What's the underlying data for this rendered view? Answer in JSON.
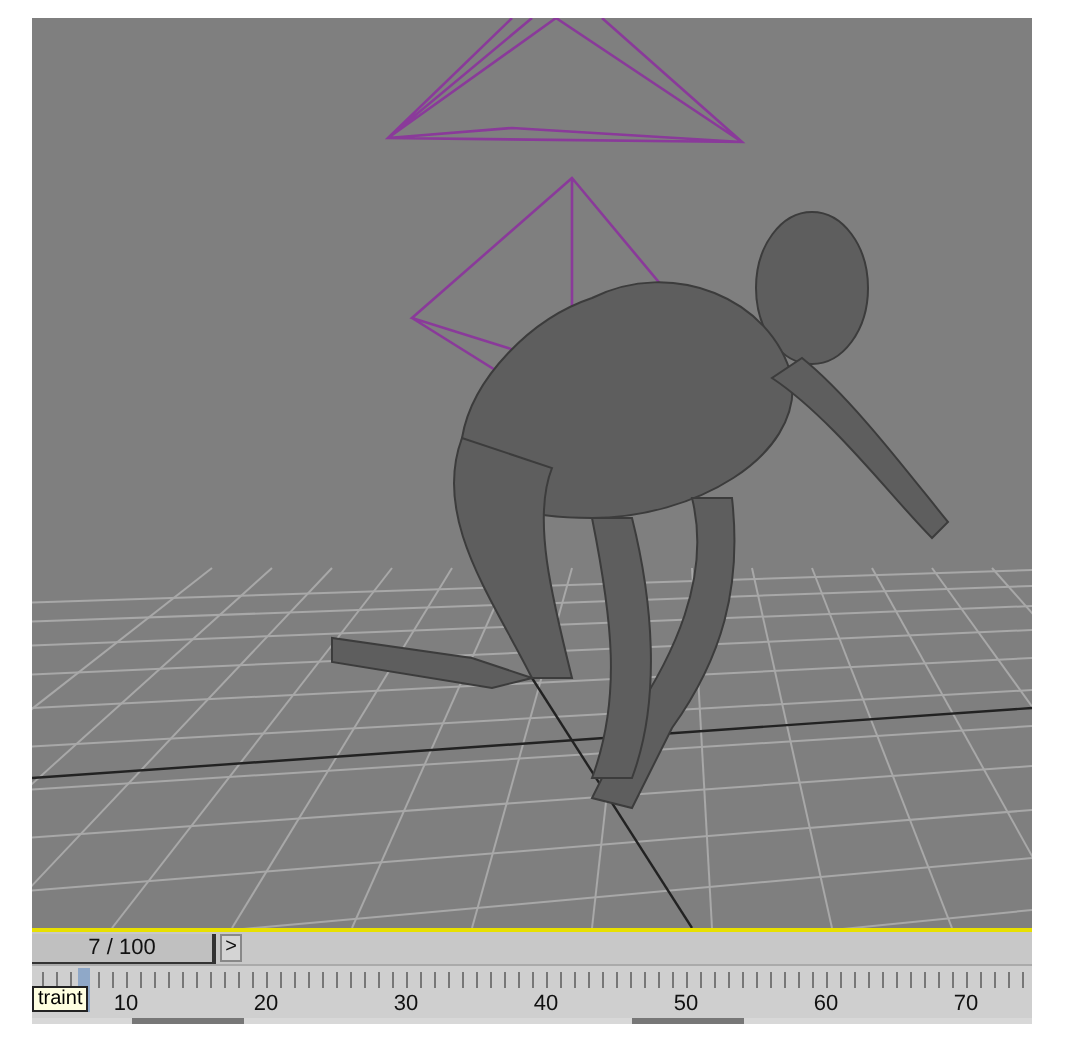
{
  "viewport": {
    "frame_field": "7 / 100",
    "next_button": ">"
  },
  "timeline": {
    "level": 0.07,
    "tooltip": "traint",
    "labels": [
      "10",
      "20",
      "30",
      "40",
      "50",
      "60",
      "70"
    ]
  }
}
